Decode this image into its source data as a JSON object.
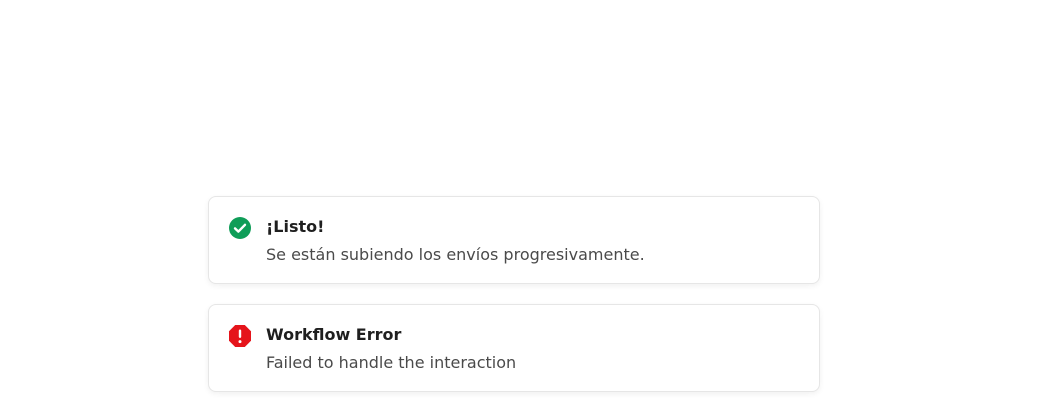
{
  "toasts": [
    {
      "type": "success",
      "icon": "check-circle-icon",
      "title": "¡Listo!",
      "message": "Se están subiendo los envíos progresivamente.",
      "color": "#0f9d58"
    },
    {
      "type": "error",
      "icon": "octagon-alert-icon",
      "title": "Workflow Error",
      "message": "Failed to handle the interaction",
      "color": "#e5141b"
    }
  ]
}
